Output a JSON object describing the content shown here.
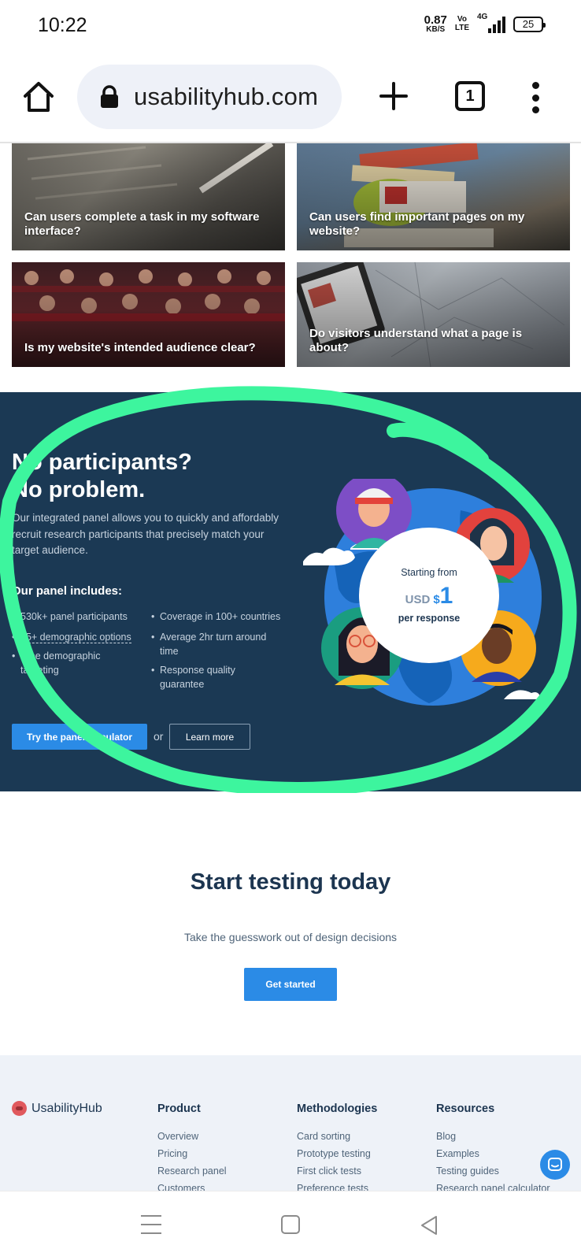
{
  "status_bar": {
    "time": "10:22",
    "net_speed_value": "0.87",
    "net_speed_unit": "KB/S",
    "volte_top": "Vo",
    "volte_bottom": "LTE",
    "network_type": "4G",
    "battery": "25"
  },
  "browser": {
    "url": "usabilityhub.com",
    "tab_count": "1"
  },
  "cards": [
    {
      "caption": "Can users complete a task in my software interface?"
    },
    {
      "caption": "Can users find important pages on my website?"
    },
    {
      "caption": "Is my website's intended audience clear?"
    },
    {
      "caption": "Do visitors understand what a page is about?"
    }
  ],
  "panel": {
    "title": "No participants?\nNo problem.",
    "description": "Our integrated panel allows you to quickly and affordably recruit research participants that precisely match your target audience.",
    "includes_title": "Our panel includes:",
    "features_left": [
      "530k+ panel participants",
      "35+ demographic options",
      "Free demographic targeting"
    ],
    "features_right": [
      "Coverage in 100+ countries",
      "Average 2hr turn around time",
      "Response quality guarantee"
    ],
    "primary_button": "Try the panel calculator",
    "or_text": "or",
    "secondary_button": "Learn more",
    "price": {
      "starting": "Starting from",
      "currency": "USD",
      "symbol": "$",
      "amount": "1",
      "per": "per response"
    },
    "highlight_color": "#3df59e"
  },
  "start": {
    "title": "Start testing today",
    "subtitle": "Take the guesswork out of design decisions",
    "button": "Get started"
  },
  "footer": {
    "brand": "UsabilityHub",
    "columns": [
      {
        "title": "Product",
        "links": [
          "Overview",
          "Pricing",
          "Research panel",
          "Customers"
        ]
      },
      {
        "title": "Methodologies",
        "links": [
          "Card sorting",
          "Prototype testing",
          "First click tests",
          "Preference tests"
        ]
      },
      {
        "title": "Resources",
        "links": [
          "Blog",
          "Examples",
          "Testing guides",
          "Research panel calculator"
        ]
      }
    ]
  },
  "colors": {
    "panel_bg": "#1b3954",
    "accent_blue": "#2b8be6",
    "heading": "#1c3550"
  }
}
